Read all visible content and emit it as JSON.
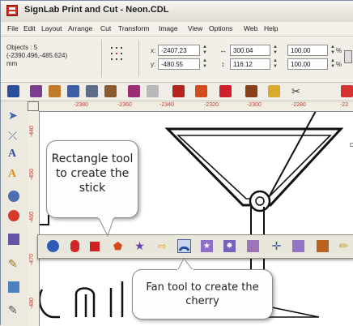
{
  "window": {
    "title": "SignLab Print and Cut - Neon.CDL"
  },
  "menu": {
    "items": [
      "File",
      "Edit",
      "Layout",
      "Arrange",
      "Cut",
      "Transform",
      "Image",
      "View",
      "Options",
      "Web",
      "Help"
    ]
  },
  "properties": {
    "objects_label": "Objects : 5",
    "coords": "(-2390.496,-485.624)",
    "units": "mm",
    "x_label": "x:",
    "x_value": "-2407.23",
    "y_label": "y:",
    "y_value": "-480.55",
    "width_value": "300.04",
    "height_value": "116.12",
    "scale_x_value": "100.00",
    "scale_y_value": "100.00",
    "percent_x": "%",
    "percent_y": "%"
  },
  "rulers": {
    "horizontal": [
      "-2380",
      "-2360",
      "-2340",
      "-2320",
      "-2300",
      "-2280",
      "-22"
    ],
    "vertical": [
      "-440",
      "-450",
      "-460",
      "-470",
      "-480"
    ]
  },
  "callouts": {
    "rectangle_tool": "Rectangle tool to create the stick",
    "fan_tool": "Fan tool to create the cherry"
  },
  "icons": {
    "toolbar": [
      "open-folder-icon",
      "import-icon",
      "export-icon",
      "print-icon",
      "preview-icon",
      "cut-icon",
      "undo-icon",
      "redo-icon",
      "transform-icon",
      "color-icon",
      "layer-icon",
      "image-icon",
      "scissors-icon"
    ],
    "flyout": [
      "ellipse-icon",
      "oval-icon",
      "rectangle-icon",
      "pentagon-icon",
      "star-icon",
      "arrow-icon",
      "fan-icon",
      "star-frame-icon",
      "starburst-icon",
      "blob-icon",
      "crosshair-icon",
      "shape-grid-icon",
      "texture-icon",
      "pencil-icon"
    ]
  },
  "colors": {
    "accent": "#3d5f9c",
    "ruler_text": "#c23b2e",
    "brand_red": "#d62a1f"
  }
}
